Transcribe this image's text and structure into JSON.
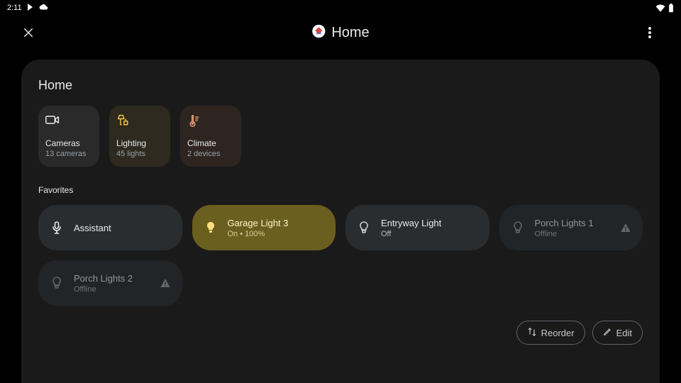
{
  "status": {
    "time": "2:11"
  },
  "header": {
    "title": "Home"
  },
  "panel": {
    "title": "Home",
    "categories": [
      {
        "icon": "camera",
        "label": "Cameras",
        "sub": "13 cameras"
      },
      {
        "icon": "lamp",
        "label": "Lighting",
        "sub": "45 lights"
      },
      {
        "icon": "thermo",
        "label": "Climate",
        "sub": "2 devices"
      }
    ],
    "favorites_title": "Favorites",
    "favorites": [
      {
        "kind": "assistant",
        "title": "Assistant",
        "sub": ""
      },
      {
        "kind": "light-on",
        "title": "Garage Light 3",
        "sub": "On • 100%"
      },
      {
        "kind": "light-off",
        "title": "Entryway Light",
        "sub": "Off"
      },
      {
        "kind": "offline",
        "title": "Porch Lights 1",
        "sub": "Offline"
      },
      {
        "kind": "offline",
        "title": "Porch Lights 2",
        "sub": "Offline"
      }
    ],
    "actions": {
      "reorder": "Reorder",
      "edit": "Edit"
    }
  }
}
